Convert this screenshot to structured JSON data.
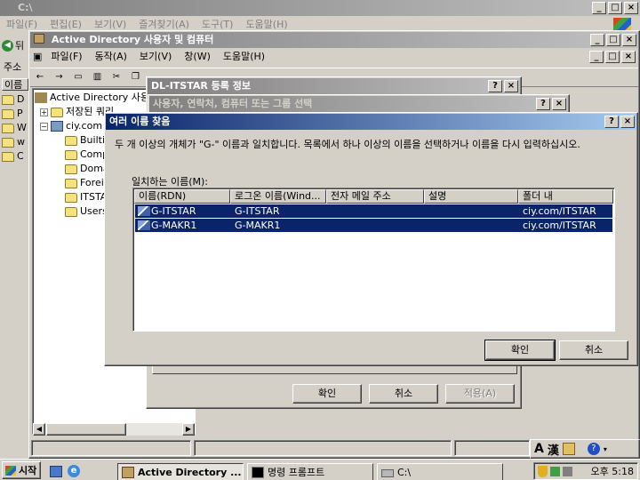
{
  "explorer": {
    "title": "C:\\",
    "menu": [
      "파일(F)",
      "편집(E)",
      "보기(V)",
      "즐겨찾기(A)",
      "도구(T)",
      "도움말(H)"
    ],
    "back_label": "뒤",
    "address_label": "주소",
    "name_col": "이름",
    "left_items": [
      "D",
      "P",
      "W",
      "w",
      "C"
    ]
  },
  "aduc": {
    "title": "Active Directory 사용자 및 컴퓨터",
    "menu": [
      "파일(F)",
      "동작(A)",
      "보기(V)",
      "창(W)",
      "도움말(H)"
    ],
    "tree": {
      "root": "Active Directory 사용자",
      "saved": "저장된 쿼리",
      "domain": "ciy.com",
      "children": [
        "Builtin",
        "Comp",
        "Doma",
        "Forei",
        "ITSTA",
        "Users"
      ]
    }
  },
  "dl_props": {
    "title": "DL-ITSTAR 등록 정보",
    "ok": "확인",
    "cancel": "취소",
    "apply": "적용(A)"
  },
  "select_dialog": {
    "title": "사용자, 연락처, 컴퓨터 또는 그룹 선택"
  },
  "multi_names": {
    "title": "여러 이름 찾음",
    "message": "두 개 이상의 개체가 \"G-\" 이름과 일치합니다. 목록에서 하나 이상의 이름을 선택하거나 이름을 다시 입력하십시오.",
    "match_label": "일치하는 이름(M):",
    "columns": [
      "이름(RDN)",
      "로그온 이름(Wind...",
      "전자 메일 주소",
      "설명",
      "폴더 내"
    ],
    "rows": [
      {
        "name": "G-ITSTAR",
        "logon": "G-ITSTAR",
        "email": "",
        "desc": "",
        "folder": "ciy.com/ITSTAR"
      },
      {
        "name": "G-MAKR1",
        "logon": "G-MAKR1",
        "email": "",
        "desc": "",
        "folder": "ciy.com/ITSTAR"
      }
    ],
    "ok": "확인",
    "cancel": "취소"
  },
  "caption": {
    "help": "?",
    "close": "×",
    "min": "_",
    "max": "□"
  },
  "taskbar": {
    "start": "시작",
    "tasks": [
      "Active Directory ...",
      "명령 프롬프트",
      "C:\\"
    ],
    "clock": "오후 5:18"
  },
  "langbar": {
    "a": "A",
    "han": "漢"
  },
  "colors": {
    "title_active": "#0a246a",
    "selection": "#0a246a",
    "face": "#d4d0c8"
  }
}
